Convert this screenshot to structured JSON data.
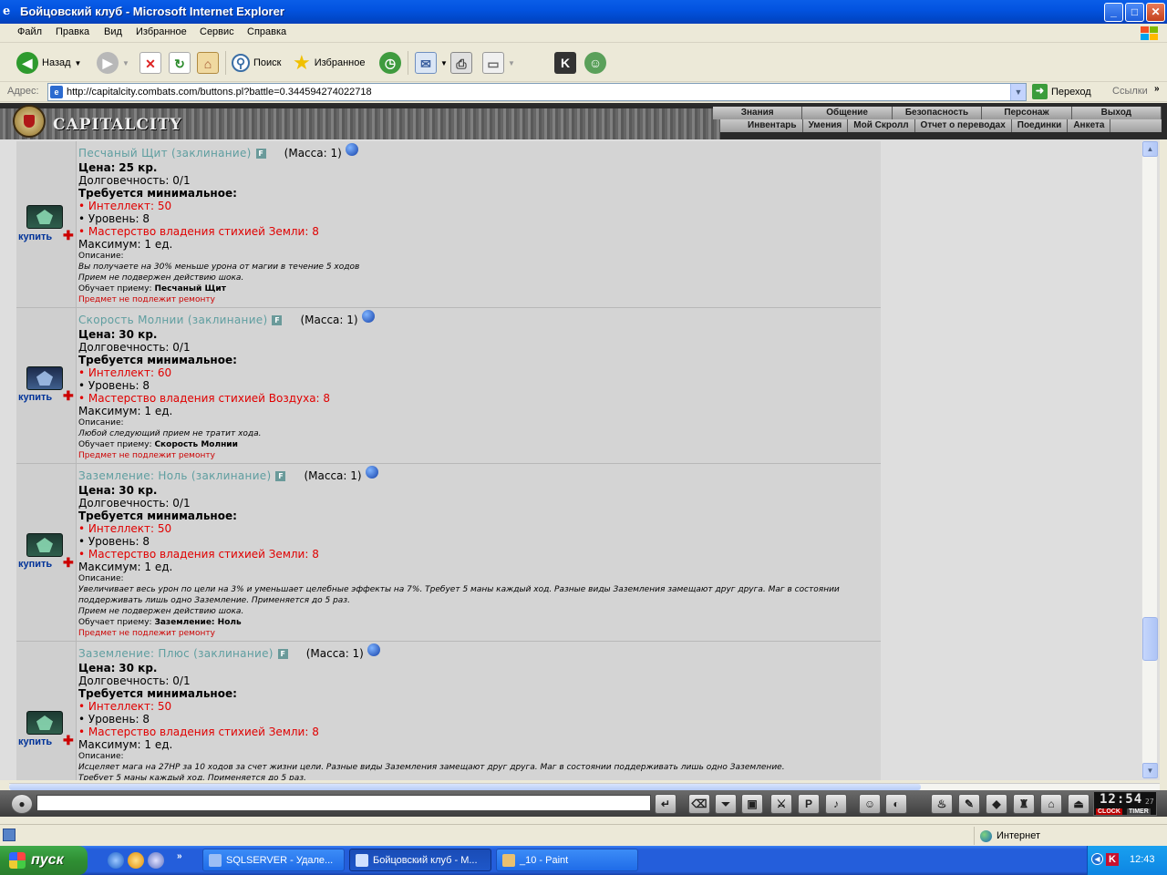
{
  "window": {
    "title": "Бойцовский клуб - Microsoft Internet Explorer",
    "min": "_",
    "max": "□",
    "close": "✕"
  },
  "menu": [
    "Файл",
    "Правка",
    "Вид",
    "Избранное",
    "Сервис",
    "Справка"
  ],
  "toolbar": {
    "back": "Назад",
    "search": "Поиск",
    "favorites": "Избранное"
  },
  "address": {
    "label": "Адрес:",
    "url": "http://capitalcity.combats.com/buttons.pl?battle=0.344594274022718",
    "go": "Переход",
    "links": "Ссылки"
  },
  "game": {
    "logo": "CAPITALCITY",
    "nav_top": [
      "Знания",
      "Общение",
      "Безопасность",
      "Персонаж",
      "Выход"
    ],
    "nav_bottom": [
      "Инвентарь",
      "Умения",
      "Мой Скролл",
      "Отчет о переводах",
      "Поединки",
      "Анкета"
    ]
  },
  "items": [
    {
      "name": "Песчаный Щит (заклинание)",
      "mass": "(Масса: 1)",
      "price_label": "Цена:",
      "price": "25 кр.",
      "durability": "Долговечность: 0/1",
      "req_title": "Требуется минимальное:",
      "req1": "• Интеллект: 50",
      "req2": "• Уровень: 8",
      "req3": "• Мастерство владения стихией Земли: 8",
      "max": "Максимум: 1 ед.",
      "desc_label": "Описание:",
      "desc": "Вы получаете на 30% меньше урона от магии в течение 5 ходов",
      "desc2": "Прием не подвержен действию шока.",
      "teaches_label": "Обучает приему:",
      "teaches": "Песчаный Щит",
      "repair": "Предмет не подлежит ремонту",
      "buy": "купить",
      "icon": "green"
    },
    {
      "name": "Скорость Молнии (заклинание)",
      "mass": "(Масса: 1)",
      "price_label": "Цена:",
      "price": "30 кр.",
      "durability": "Долговечность: 0/1",
      "req_title": "Требуется минимальное:",
      "req1": "• Интеллект: 60",
      "req2": "• Уровень: 8",
      "req3": "• Мастерство владения стихией Воздуха: 8",
      "max": "Максимум: 1 ед.",
      "desc_label": "Описание:",
      "desc": "Любой следующий прием не тратит хода.",
      "desc2": "",
      "teaches_label": "Обучает приему:",
      "teaches": "Скорость Молнии",
      "repair": "Предмет не подлежит ремонту",
      "buy": "купить",
      "icon": "blue"
    },
    {
      "name": "Заземление: Ноль (заклинание)",
      "mass": "(Масса: 1)",
      "price_label": "Цена:",
      "price": "30 кр.",
      "durability": "Долговечность: 0/1",
      "req_title": "Требуется минимальное:",
      "req1": "• Интеллект: 50",
      "req2": "• Уровень: 8",
      "req3": "• Мастерство владения стихией Земли: 8",
      "max": "Максимум: 1 ед.",
      "desc_label": "Описание:",
      "desc": "Увеличивает весь урон по цели на 3% и уменьшает целебные эффекты на 7%. Требует 5 маны каждый ход. Разные виды Заземления замещают друг друга. Маг в состоянии поддерживать лишь одно Заземление. Применяется до 5 раз.",
      "desc2": "Прием не подвержен действию шока.",
      "teaches_label": "Обучает приему:",
      "teaches": "Заземление: Ноль",
      "repair": "Предмет не подлежит ремонту",
      "buy": "купить",
      "icon": "green"
    },
    {
      "name": "Заземление: Плюс (заклинание)",
      "mass": "(Масса: 1)",
      "price_label": "Цена:",
      "price": "30 кр.",
      "durability": "Долговечность: 0/1",
      "req_title": "Требуется минимальное:",
      "req1": "• Интеллект: 50",
      "req2": "• Уровень: 8",
      "req3": "• Мастерство владения стихией Земли: 8",
      "max": "Максимум: 1 ед.",
      "desc_label": "Описание:",
      "desc": "Исцеляет мага на 27HP за 10 ходов за счет жизни цели. Разные виды Заземления замещают друг друга. Маг в состоянии поддерживать лишь одно Заземление.",
      "desc2": "Требует 5 маны каждый ход. Применяется до 5 раз.",
      "teaches_label": "",
      "teaches": "",
      "repair": "",
      "buy": "купить",
      "icon": "green"
    }
  ],
  "clock": {
    "time": "12:54",
    "sec": "27",
    "clock_label": "CLOCK",
    "timer_label": "TIMER"
  },
  "statusbar": {
    "zone": "Интернет"
  },
  "taskbar": {
    "start": "пуск",
    "tasks": [
      "SQLSERVER - Удале...",
      "Бойцовский клуб - М...",
      "_10 - Paint"
    ],
    "time": "12:43"
  }
}
